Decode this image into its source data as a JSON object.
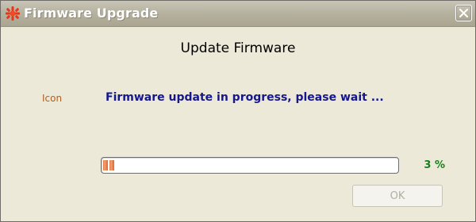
{
  "window": {
    "title": "Firmware Upgrade",
    "close_icon": "close-icon",
    "app_icon": "splat-icon"
  },
  "content": {
    "heading": "Update Firmware",
    "icon_placeholder": "Icon",
    "status_text": "Firmware update in progress, please wait ..."
  },
  "progress": {
    "value_percent": 3,
    "label": "3 %"
  },
  "buttons": {
    "ok_label": "OK",
    "ok_enabled": false
  },
  "colors": {
    "titlebar": "#b7b3a1",
    "dialog_bg": "#ece9d8",
    "status_text": "#16178c",
    "percent_text": "#17801a",
    "icon_placeholder_text": "#b06020",
    "progress_fill": "#e4723d"
  }
}
